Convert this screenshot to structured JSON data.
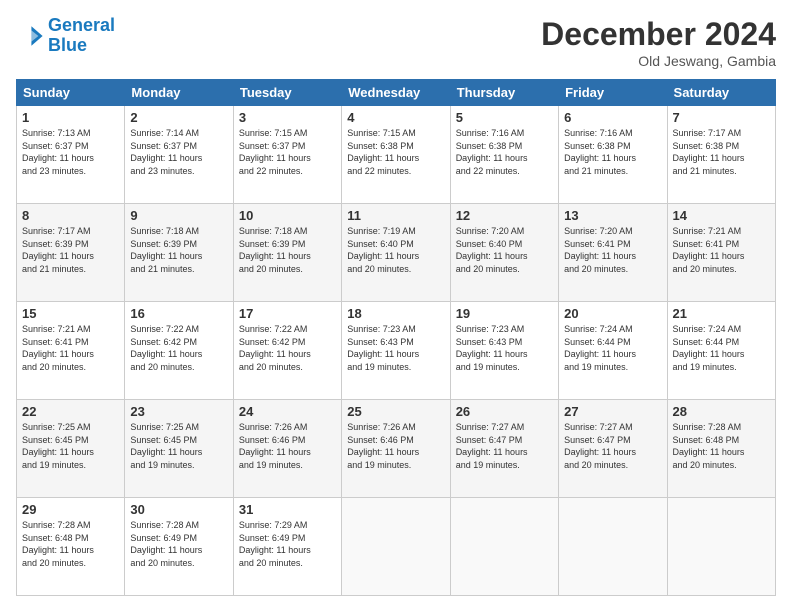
{
  "header": {
    "logo_line1": "General",
    "logo_line2": "Blue",
    "title": "December 2024",
    "subtitle": "Old Jeswang, Gambia"
  },
  "weekdays": [
    "Sunday",
    "Monday",
    "Tuesday",
    "Wednesday",
    "Thursday",
    "Friday",
    "Saturday"
  ],
  "weeks": [
    [
      {
        "day": "1",
        "info": "Sunrise: 7:13 AM\nSunset: 6:37 PM\nDaylight: 11 hours\nand 23 minutes."
      },
      {
        "day": "2",
        "info": "Sunrise: 7:14 AM\nSunset: 6:37 PM\nDaylight: 11 hours\nand 23 minutes."
      },
      {
        "day": "3",
        "info": "Sunrise: 7:15 AM\nSunset: 6:37 PM\nDaylight: 11 hours\nand 22 minutes."
      },
      {
        "day": "4",
        "info": "Sunrise: 7:15 AM\nSunset: 6:38 PM\nDaylight: 11 hours\nand 22 minutes."
      },
      {
        "day": "5",
        "info": "Sunrise: 7:16 AM\nSunset: 6:38 PM\nDaylight: 11 hours\nand 22 minutes."
      },
      {
        "day": "6",
        "info": "Sunrise: 7:16 AM\nSunset: 6:38 PM\nDaylight: 11 hours\nand 21 minutes."
      },
      {
        "day": "7",
        "info": "Sunrise: 7:17 AM\nSunset: 6:38 PM\nDaylight: 11 hours\nand 21 minutes."
      }
    ],
    [
      {
        "day": "8",
        "info": "Sunrise: 7:17 AM\nSunset: 6:39 PM\nDaylight: 11 hours\nand 21 minutes."
      },
      {
        "day": "9",
        "info": "Sunrise: 7:18 AM\nSunset: 6:39 PM\nDaylight: 11 hours\nand 21 minutes."
      },
      {
        "day": "10",
        "info": "Sunrise: 7:18 AM\nSunset: 6:39 PM\nDaylight: 11 hours\nand 20 minutes."
      },
      {
        "day": "11",
        "info": "Sunrise: 7:19 AM\nSunset: 6:40 PM\nDaylight: 11 hours\nand 20 minutes."
      },
      {
        "day": "12",
        "info": "Sunrise: 7:20 AM\nSunset: 6:40 PM\nDaylight: 11 hours\nand 20 minutes."
      },
      {
        "day": "13",
        "info": "Sunrise: 7:20 AM\nSunset: 6:41 PM\nDaylight: 11 hours\nand 20 minutes."
      },
      {
        "day": "14",
        "info": "Sunrise: 7:21 AM\nSunset: 6:41 PM\nDaylight: 11 hours\nand 20 minutes."
      }
    ],
    [
      {
        "day": "15",
        "info": "Sunrise: 7:21 AM\nSunset: 6:41 PM\nDaylight: 11 hours\nand 20 minutes."
      },
      {
        "day": "16",
        "info": "Sunrise: 7:22 AM\nSunset: 6:42 PM\nDaylight: 11 hours\nand 20 minutes."
      },
      {
        "day": "17",
        "info": "Sunrise: 7:22 AM\nSunset: 6:42 PM\nDaylight: 11 hours\nand 20 minutes."
      },
      {
        "day": "18",
        "info": "Sunrise: 7:23 AM\nSunset: 6:43 PM\nDaylight: 11 hours\nand 19 minutes."
      },
      {
        "day": "19",
        "info": "Sunrise: 7:23 AM\nSunset: 6:43 PM\nDaylight: 11 hours\nand 19 minutes."
      },
      {
        "day": "20",
        "info": "Sunrise: 7:24 AM\nSunset: 6:44 PM\nDaylight: 11 hours\nand 19 minutes."
      },
      {
        "day": "21",
        "info": "Sunrise: 7:24 AM\nSunset: 6:44 PM\nDaylight: 11 hours\nand 19 minutes."
      }
    ],
    [
      {
        "day": "22",
        "info": "Sunrise: 7:25 AM\nSunset: 6:45 PM\nDaylight: 11 hours\nand 19 minutes."
      },
      {
        "day": "23",
        "info": "Sunrise: 7:25 AM\nSunset: 6:45 PM\nDaylight: 11 hours\nand 19 minutes."
      },
      {
        "day": "24",
        "info": "Sunrise: 7:26 AM\nSunset: 6:46 PM\nDaylight: 11 hours\nand 19 minutes."
      },
      {
        "day": "25",
        "info": "Sunrise: 7:26 AM\nSunset: 6:46 PM\nDaylight: 11 hours\nand 19 minutes."
      },
      {
        "day": "26",
        "info": "Sunrise: 7:27 AM\nSunset: 6:47 PM\nDaylight: 11 hours\nand 19 minutes."
      },
      {
        "day": "27",
        "info": "Sunrise: 7:27 AM\nSunset: 6:47 PM\nDaylight: 11 hours\nand 20 minutes."
      },
      {
        "day": "28",
        "info": "Sunrise: 7:28 AM\nSunset: 6:48 PM\nDaylight: 11 hours\nand 20 minutes."
      }
    ],
    [
      {
        "day": "29",
        "info": "Sunrise: 7:28 AM\nSunset: 6:48 PM\nDaylight: 11 hours\nand 20 minutes."
      },
      {
        "day": "30",
        "info": "Sunrise: 7:28 AM\nSunset: 6:49 PM\nDaylight: 11 hours\nand 20 minutes."
      },
      {
        "day": "31",
        "info": "Sunrise: 7:29 AM\nSunset: 6:49 PM\nDaylight: 11 hours\nand 20 minutes."
      },
      null,
      null,
      null,
      null
    ]
  ]
}
